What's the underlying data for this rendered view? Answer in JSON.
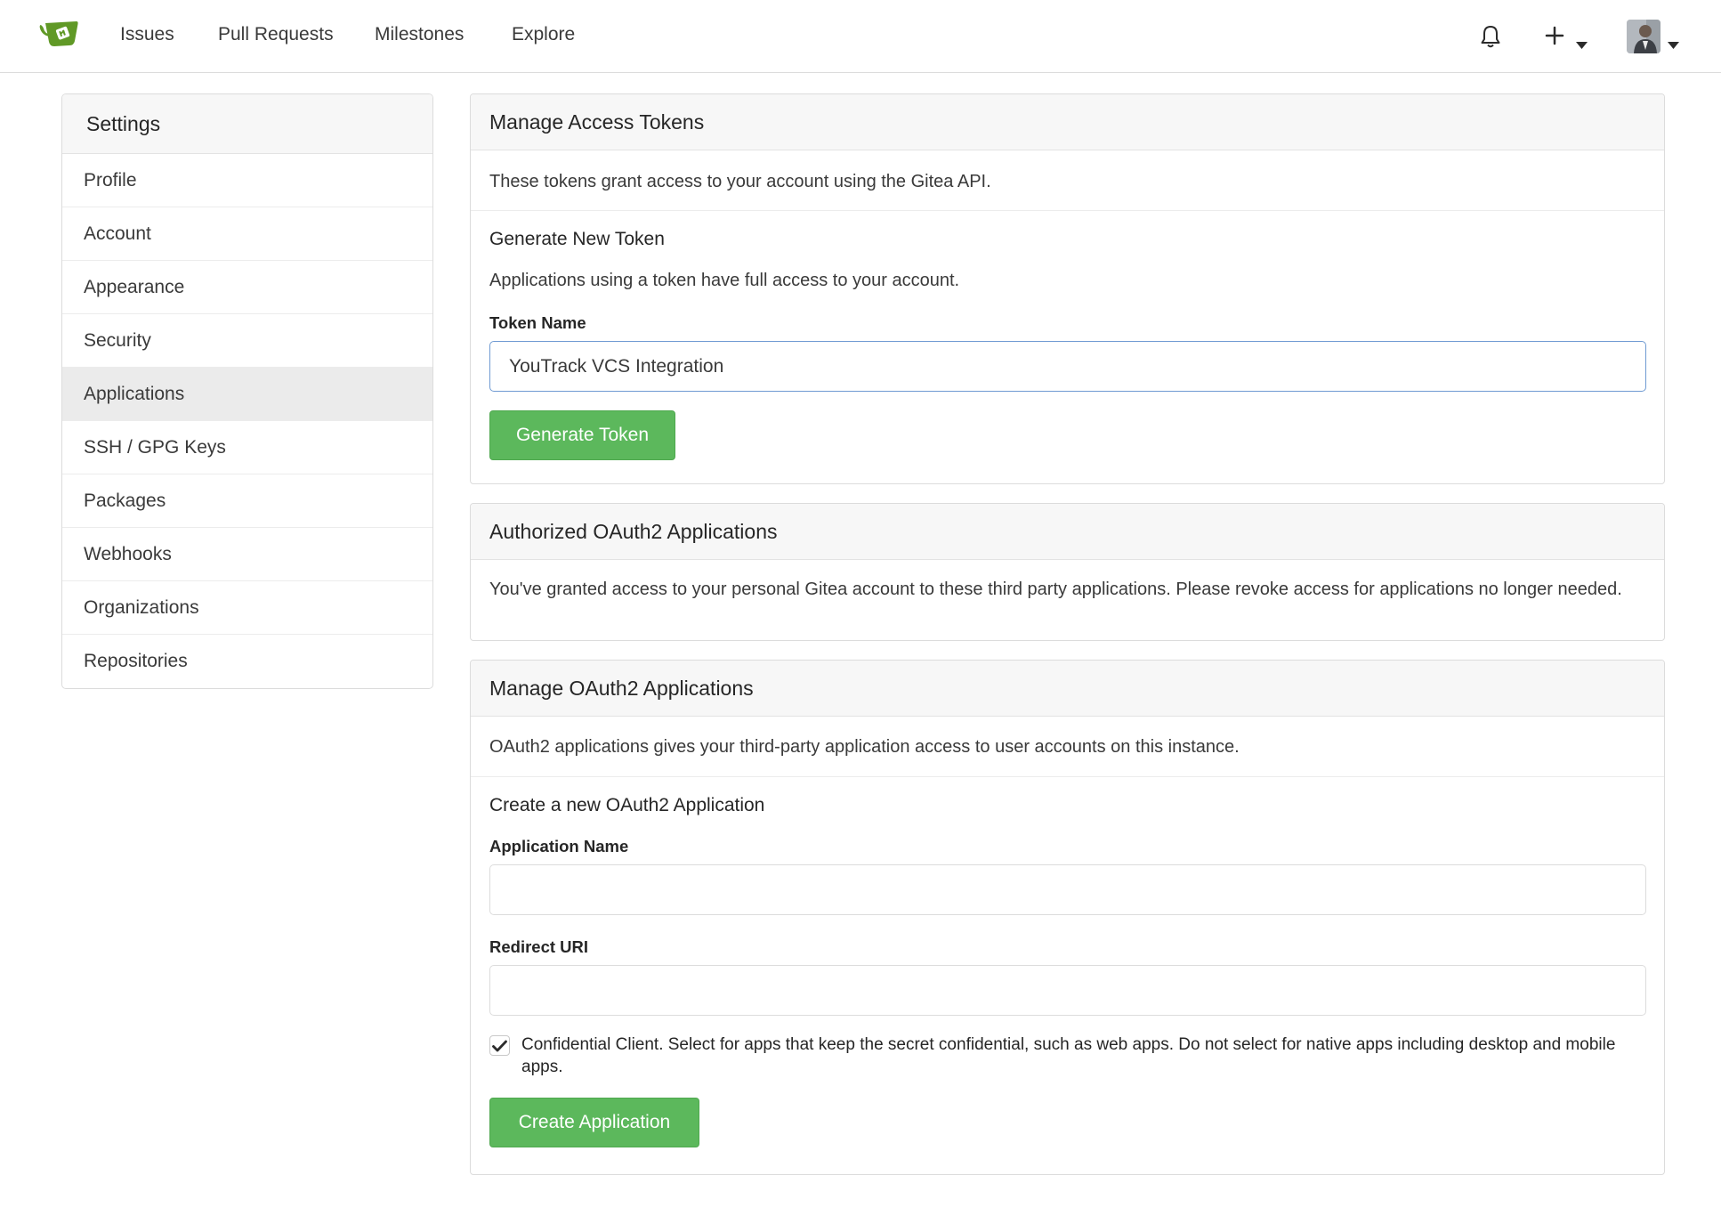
{
  "nav": {
    "links": [
      "Issues",
      "Pull Requests",
      "Milestones",
      "Explore"
    ],
    "icons": {
      "logo": "gitea-teacup-logo",
      "notifications": "bell-icon",
      "create": "plus-icon",
      "dropdown": "caret-down-icon",
      "avatar": "user-avatar"
    }
  },
  "sidebar": {
    "title": "Settings",
    "items": [
      {
        "label": "Profile",
        "active": false
      },
      {
        "label": "Account",
        "active": false
      },
      {
        "label": "Appearance",
        "active": false
      },
      {
        "label": "Security",
        "active": false
      },
      {
        "label": "Applications",
        "active": true
      },
      {
        "label": "SSH / GPG Keys",
        "active": false
      },
      {
        "label": "Packages",
        "active": false
      },
      {
        "label": "Webhooks",
        "active": false
      },
      {
        "label": "Organizations",
        "active": false
      },
      {
        "label": "Repositories",
        "active": false
      }
    ]
  },
  "tokens": {
    "title": "Manage Access Tokens",
    "description": "These tokens grant access to your account using the Gitea API.",
    "generate_title": "Generate New Token",
    "generate_desc": "Applications using a token have full access to your account.",
    "token_name_label": "Token Name",
    "token_name_value": "YouTrack VCS Integration",
    "generate_button": "Generate Token"
  },
  "authorized": {
    "title": "Authorized OAuth2 Applications",
    "description": "You've granted access to your personal Gitea account to these third party applications. Please revoke access for applications no longer needed."
  },
  "oauth": {
    "title": "Manage OAuth2 Applications",
    "description": "OAuth2 applications gives your third-party application access to user accounts on this instance.",
    "create_title": "Create a new OAuth2 Application",
    "app_name_label": "Application Name",
    "app_name_value": "",
    "redirect_label": "Redirect URI",
    "redirect_value": "",
    "confidential_checked": true,
    "confidential_label": "Confidential Client. Select for apps that keep the secret confidential, such as web apps. Do not select for native apps including desktop and mobile apps.",
    "create_button": "Create Application"
  },
  "colors": {
    "brand_green": "#609926",
    "button_green": "#5cb85c",
    "focus_border": "#6f9ad2",
    "active_item_bg": "#ebebeb"
  }
}
